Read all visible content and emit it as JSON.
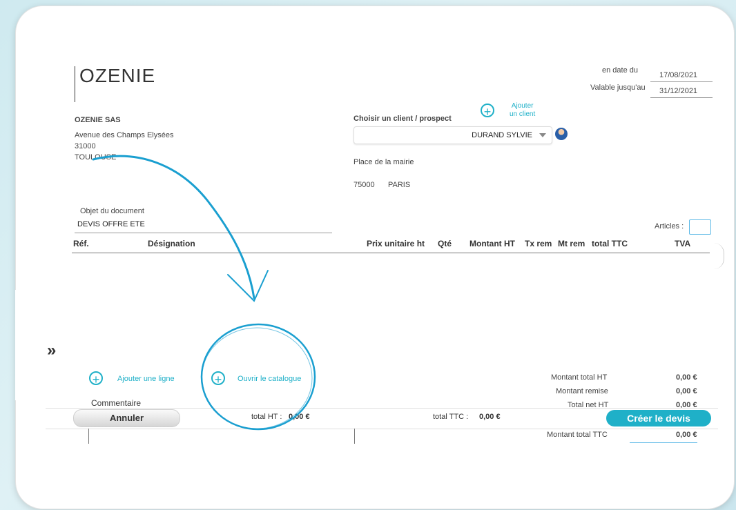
{
  "company": {
    "logo": "OZENIE",
    "name": "OZENIE SAS",
    "address_line1": "Avenue des Champs Elysées",
    "address_line2": "31000",
    "address_line3": "TOULOUSE"
  },
  "dates": {
    "date_label": "en date du",
    "date_value": "17/08/2021",
    "valid_label": "Valable jusqu'au",
    "valid_value": "31/12/2021"
  },
  "client": {
    "choose_label": "Choisir un client / prospect",
    "add_label_1": "Ajouter",
    "add_label_2": "un client",
    "selected": "DURAND SYLVIE",
    "address_line1": "Place de la mairie",
    "postcode": "75000",
    "city": "PARIS"
  },
  "document": {
    "object_label": "Objet du document",
    "object_value": "DEVIS OFFRE ETE",
    "articles_label": "Articles :"
  },
  "table": {
    "headers": {
      "ref": "Réf.",
      "designation": "Désignation",
      "unit_price": "Prix unitaire ht",
      "qty": "Qté",
      "amount_ht": "Montant HT",
      "tx_rem": "Tx rem",
      "mt_rem": "Mt rem",
      "total_ttc": "total TTC",
      "tva": "TVA"
    }
  },
  "actions": {
    "add_line": "Ajouter une ligne",
    "open_catalog": "Ouvrir le catalogue",
    "comment_label": "Commentaire"
  },
  "totals": {
    "total_ht_label": "Montant total HT",
    "total_ht_value": "0,00 €",
    "remise_label": "Montant remise",
    "remise_value": "0,00 €",
    "net_ht_label": "Total net HT",
    "net_ht_value": "0,00 €",
    "total_ttc_label": "Montant total TTC",
    "total_ttc_value": "0,00 €"
  },
  "footer": {
    "cancel": "Annuler",
    "total_ht_label": "total HT :",
    "total_ht_value": "0,00 €",
    "total_ttc_label": "total TTC :",
    "total_ttc_value": "0,00 €",
    "create": "Créer le devis"
  },
  "colors": {
    "accent": "#1fb0c8"
  },
  "icons": {
    "side_toggle": "double-chevron-right-icon",
    "add": "plus-circle-icon"
  }
}
